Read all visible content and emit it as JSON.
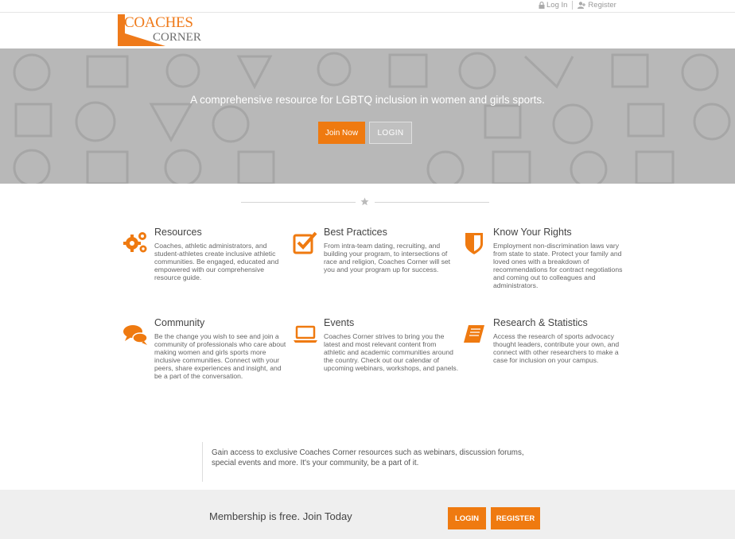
{
  "topbar": {
    "login": "Log In",
    "register": "Register"
  },
  "logo": {
    "line1": "COACHES",
    "line2": "CORNER"
  },
  "hero": {
    "tagline": "A  comprehensive resource for LGBTQ inclusion in women and girls sports.",
    "join_label": "Join Now",
    "login_label": "LOGIN"
  },
  "features": [
    {
      "icon": "gears-icon",
      "title": "Resources",
      "text": "Coaches, athletic administrators, and student-athletes create inclusive athletic communities.  Be engaged, educated and empowered with our comprehensive resource guide."
    },
    {
      "icon": "checkbox-icon",
      "title": "Best Practices",
      "text": "From intra-team dating, recruiting, and building your program, to intersections of race and religion, Coaches Corner will set you and your program up for success."
    },
    {
      "icon": "shield-icon",
      "title": "Know Your Rights",
      "text": "Employment non-discrimination laws vary from state to state. Protect your family and loved ones with a breakdown of recommendations for contract negotiations and coming out to colleagues and administrators."
    },
    {
      "icon": "chat-bubbles-icon",
      "title": "Community",
      "text": "Be the change you wish to see and join a community of professionals who care about making women and girls sports more inclusive communities. Connect with your peers, share experiences and insight, and be a part of the conversation."
    },
    {
      "icon": "laptop-icon",
      "title": "Events",
      "text": "Coaches Corner strives to bring you the latest and most relevant content from athletic and academic communities around the country. Check out our calendar of upcoming webinars, workshops, and panels."
    },
    {
      "icon": "book-icon",
      "title": "Research & Statistics",
      "text": "Access the research of sports advocacy thought leaders, contribute your own, and connect with other researchers to make a case for inclusion on your campus."
    }
  ],
  "quote": "Gain access to exclusive Coaches Corner resources such as webinars, discussion forums, special events and more. It's your community, be a part of it.",
  "band": {
    "text": "Membership is free. Join Today",
    "login_label": "LOGIN",
    "register_label": "REGISTER"
  },
  "colors": {
    "accent": "#ef7a10",
    "hero_bg": "#b8b8b8",
    "band_bg": "#efefef"
  }
}
